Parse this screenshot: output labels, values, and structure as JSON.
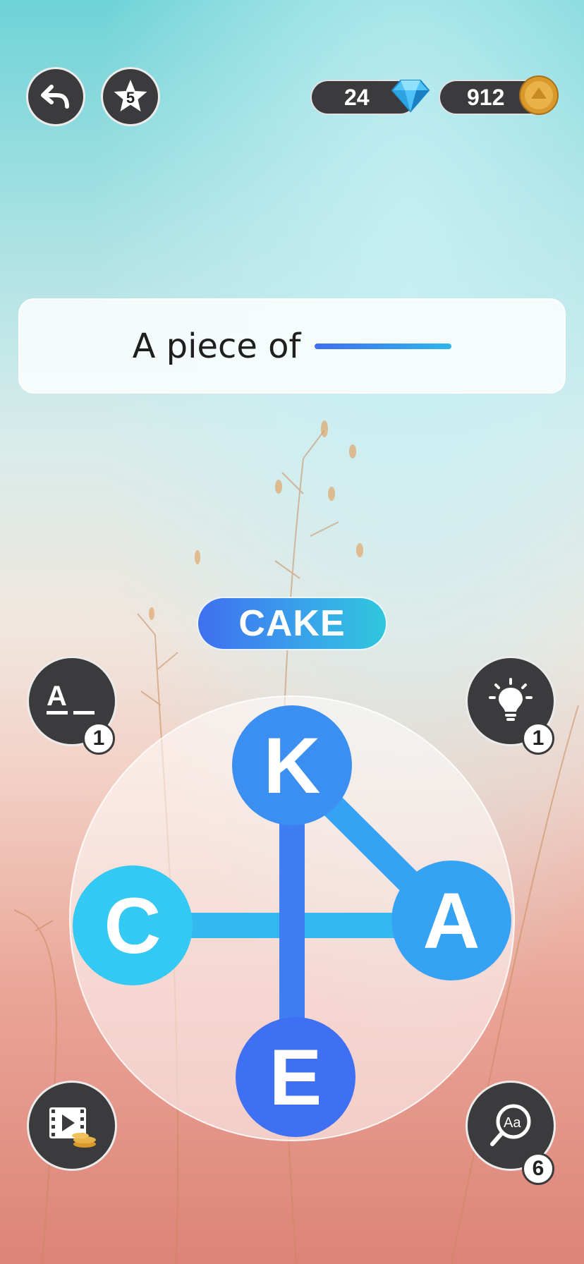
{
  "header": {
    "star_level": "5",
    "gems": "24",
    "coins": "912"
  },
  "clue": {
    "text": "A piece of"
  },
  "current_word": "CAKE",
  "wheel": {
    "letters": [
      "K",
      "C",
      "A",
      "E"
    ]
  },
  "tools": {
    "reveal_letter_count": "1",
    "hint_count": "1",
    "search_count": "6"
  },
  "icons": {
    "back": "undo-arrow-icon",
    "star": "star-icon",
    "gem": "diamond-icon",
    "coin": "coin-icon",
    "reveal": "letter-reveal-icon",
    "hint": "lightbulb-icon",
    "video": "video-reward-icon",
    "search": "magnifier-aa-icon"
  },
  "colors": {
    "letter_K": "#3b8ff0",
    "letter_C": "#33c9f2",
    "letter_A": "#36a2f3",
    "letter_E": "#3f6ff2",
    "dark": "#3b3b3d"
  }
}
